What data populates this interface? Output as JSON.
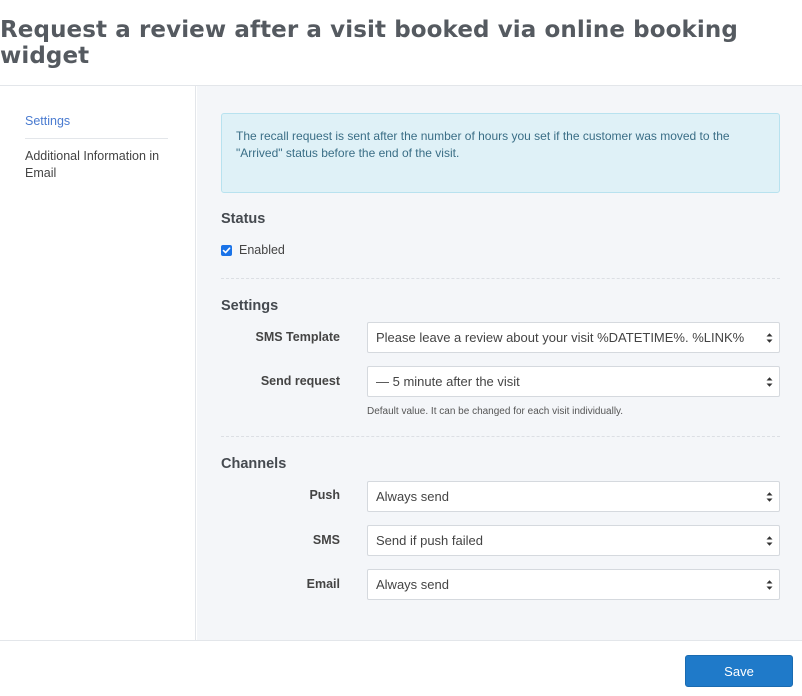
{
  "header": {
    "title": "Request a review after a visit booked via online booking widget"
  },
  "sidebar": {
    "items": [
      {
        "label": "Settings",
        "active": true
      },
      {
        "label": "Additional Information in Email",
        "active": false
      }
    ]
  },
  "info_text": "The recall request is sent after the number of hours you set if the customer was moved to the \"Arrived\" status before the end of the visit.",
  "status": {
    "title": "Status",
    "enabled_label": "Enabled",
    "enabled_checked": true
  },
  "settings": {
    "title": "Settings",
    "sms_template": {
      "label": "SMS Template",
      "value": "Please leave a review about your visit %DATETIME%. %LINK%"
    },
    "send_request": {
      "label": "Send request",
      "value": "— 5 minute after the visit",
      "hint": "Default value. It can be changed for each visit individually."
    }
  },
  "channels": {
    "title": "Channels",
    "push": {
      "label": "Push",
      "value": "Always send"
    },
    "sms": {
      "label": "SMS",
      "value": "Send if push failed"
    },
    "email": {
      "label": "Email",
      "value": "Always send"
    }
  },
  "footer": {
    "save_label": "Save"
  },
  "colors": {
    "accent": "#1f7ac9",
    "info_bg": "#dff1f7",
    "checkbox": "#1a73e8"
  }
}
